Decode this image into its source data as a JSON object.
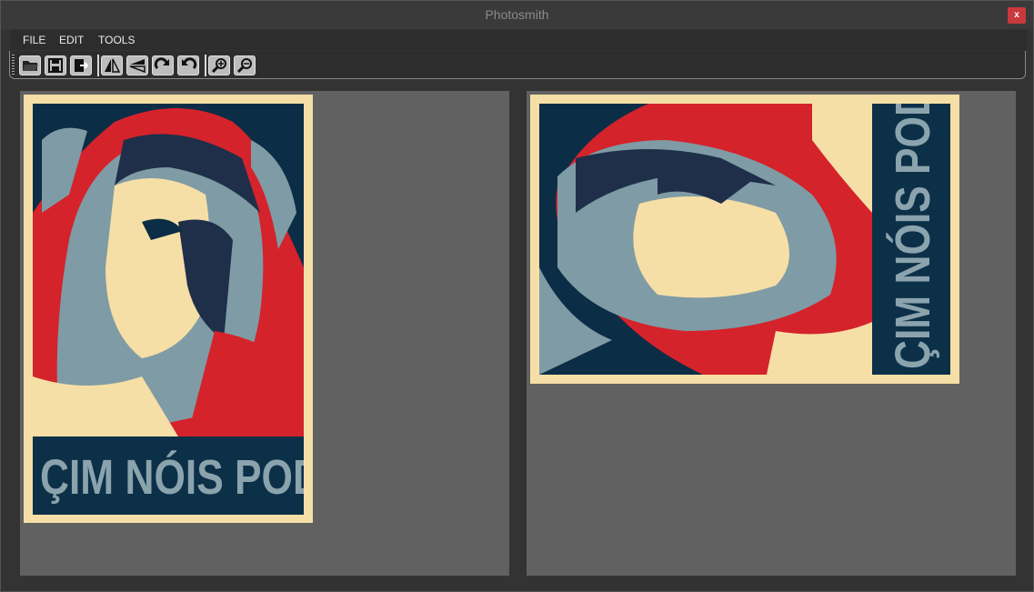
{
  "window": {
    "title": "Photosmith",
    "close_label": "x"
  },
  "menu": [
    {
      "label": "FILE"
    },
    {
      "label": "EDIT"
    },
    {
      "label": "TOOLS"
    }
  ],
  "toolbar": [
    {
      "name": "open",
      "icon": "folder-open-icon"
    },
    {
      "name": "save",
      "icon": "floppy-disk-icon"
    },
    {
      "name": "export",
      "icon": "export-icon"
    },
    {
      "name": "flip-horizontal",
      "icon": "flip-horizontal-icon"
    },
    {
      "name": "flip-vertical",
      "icon": "flip-vertical-icon"
    },
    {
      "name": "rotate-right",
      "icon": "rotate-right-icon"
    },
    {
      "name": "rotate-left",
      "icon": "rotate-left-icon"
    },
    {
      "name": "zoom-in",
      "icon": "zoom-in-icon"
    },
    {
      "name": "zoom-out",
      "icon": "zoom-out-icon"
    }
  ],
  "original_image": {
    "slogan": "ÇIM NÓIS PODE"
  },
  "rotated_image": {
    "slogan": "ÇIM NÓIS PODE"
  },
  "colors": {
    "cream": "#f6dfa6",
    "navy": "#0c2d46",
    "red": "#d4232b",
    "steel": "#7f9ba5",
    "panel": "#616161"
  }
}
